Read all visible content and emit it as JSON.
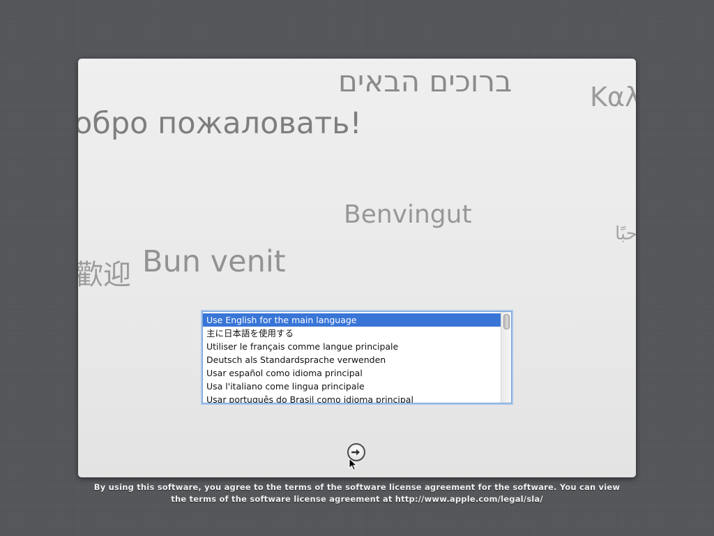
{
  "welcome_words": {
    "hebrew": "ברוכים הבאים",
    "russian": "обро пожаловать!",
    "greek": "Καλ",
    "catalan": "Benvingut",
    "arabic": "حبًا",
    "chinese": "歡迎",
    "romanian": "Bun venit"
  },
  "language_list": {
    "items": [
      "Use English for the main language",
      "主に日本語を使用する",
      "Utiliser le français comme langue principale",
      "Deutsch als Standardsprache verwenden",
      "Usar español como idioma principal",
      "Usa l'italiano come lingua principale",
      "Usar português do Brasil como idioma principal"
    ],
    "selected_index": 0
  },
  "continue_button": {
    "icon": "right-arrow-icon"
  },
  "license": {
    "line1": "By using this software, you agree to the terms of the software license agreement for the software. You can view",
    "line2": "the terms of the software license agreement at http://www.apple.com/legal/sla/"
  },
  "colors": {
    "selection": "#3875d7",
    "list_focus_ring": "#a8c6ee",
    "background": "#55575b"
  }
}
